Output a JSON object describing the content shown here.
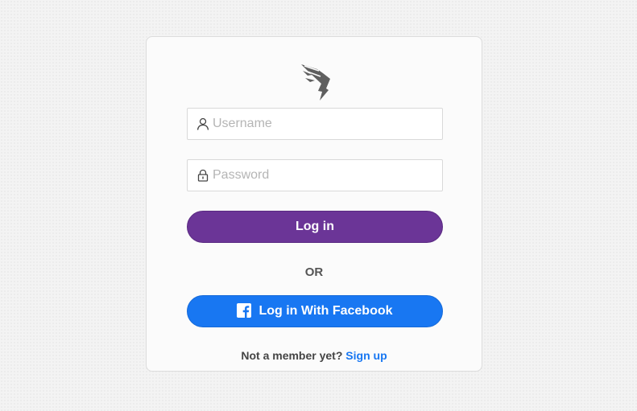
{
  "brand": {
    "logo_icon": "winged-bolt-logo-icon",
    "logo_color": "#5f5f5f"
  },
  "form": {
    "username": {
      "icon": "user-icon",
      "placeholder": "Username",
      "value": ""
    },
    "password": {
      "icon": "lock-icon",
      "placeholder": "Password",
      "value": ""
    },
    "login_button": "Log in",
    "divider": "OR",
    "facebook_button": {
      "icon": "facebook-icon",
      "label": "Log in With Facebook"
    },
    "footer": {
      "prompt": "Not a member yet?",
      "link": "Sign up"
    }
  },
  "colors": {
    "primary": "#6b3597",
    "facebook": "#1877f2",
    "link": "#1877f2"
  }
}
